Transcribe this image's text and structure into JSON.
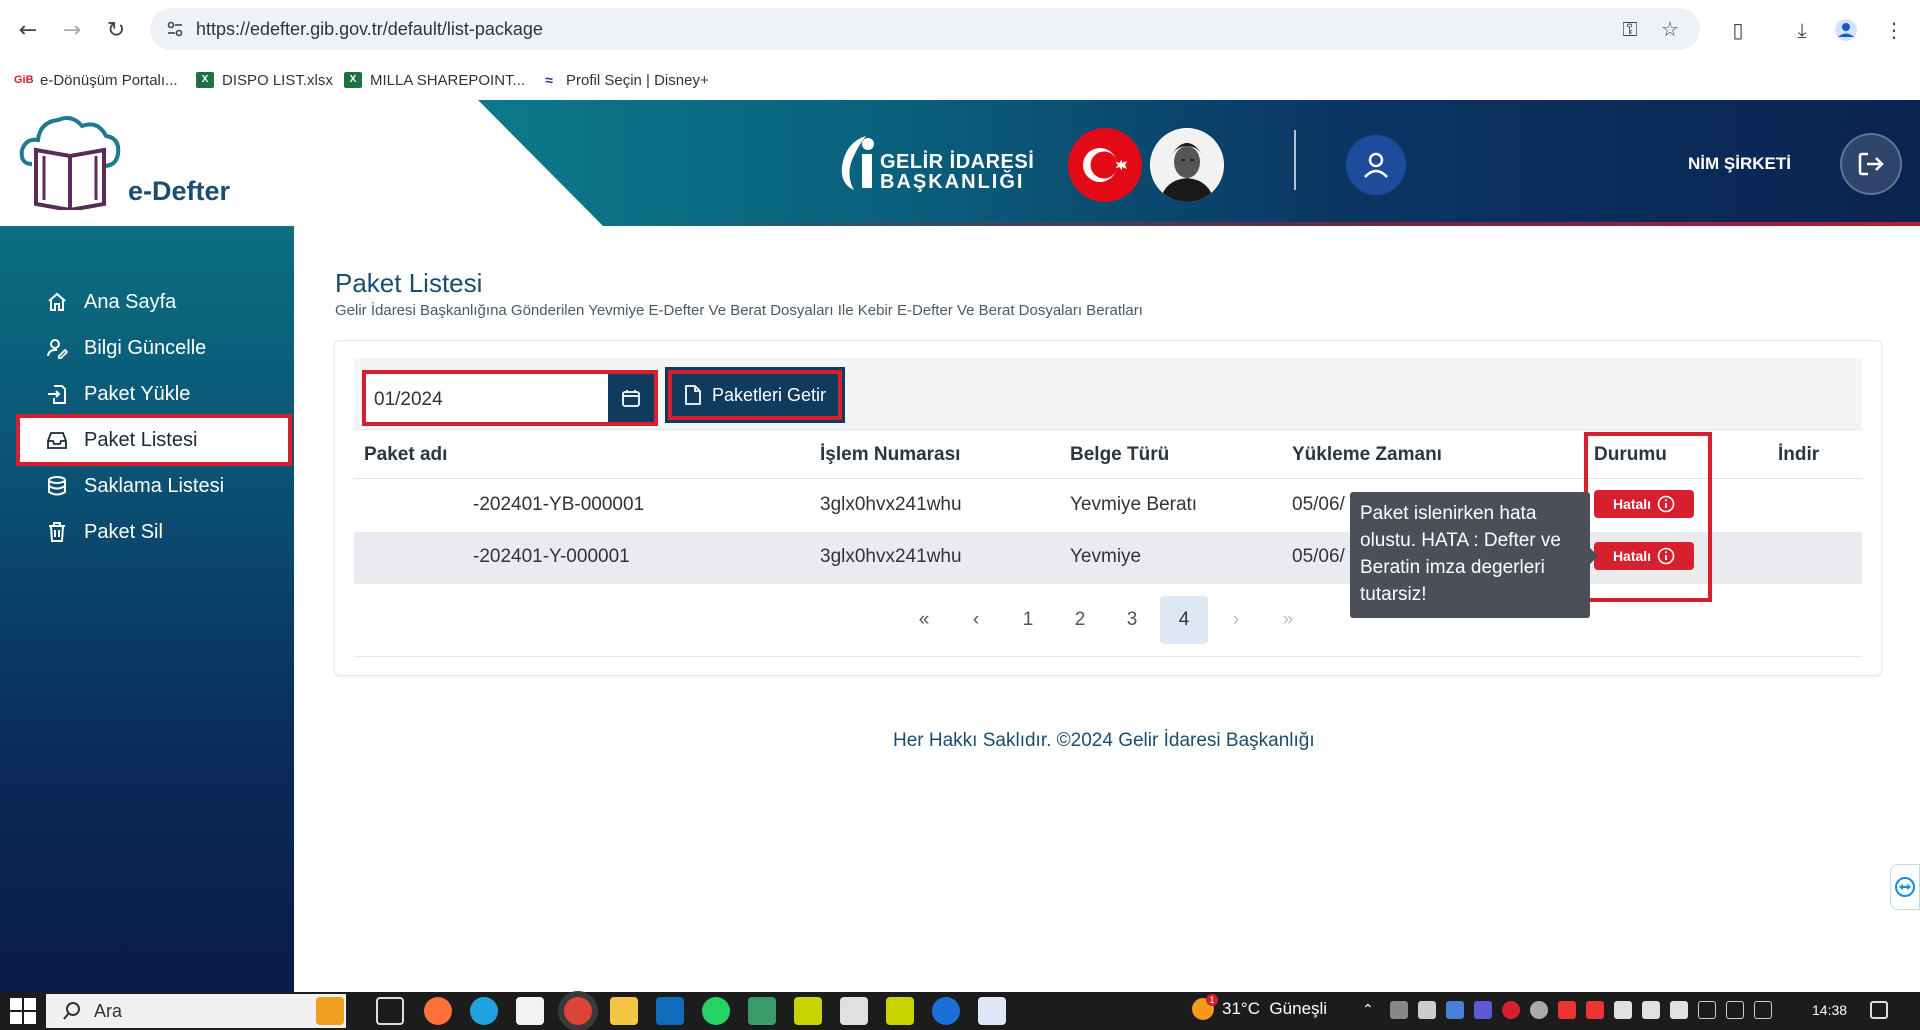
{
  "browser": {
    "url": "https://edefter.gib.gov.tr/default/list-package",
    "bookmarks": [
      {
        "label": "e-Dönüşüm Portalı...",
        "icon": "edonusum-icon",
        "color": "#d6202e"
      },
      {
        "label": "DISPO LIST.xlsx",
        "icon": "excel-icon",
        "color": "#1e7145"
      },
      {
        "label": "MILLA SHAREPOINT...",
        "icon": "excel-icon",
        "color": "#1e7145"
      },
      {
        "label": "Profil Seçin | Disney+",
        "icon": "disney-icon",
        "color": "#1a3a8c"
      }
    ]
  },
  "header": {
    "logo_text": "e-Defter",
    "gib_line1": "GELİR İDARESİ",
    "gib_line2": "BAŞKANLIĞI",
    "company": "NİM ŞİRKETİ"
  },
  "sidebar": {
    "items": [
      {
        "label": "Ana Sayfa",
        "icon": "home-icon"
      },
      {
        "label": "Bilgi Güncelle",
        "icon": "user-edit-icon"
      },
      {
        "label": "Paket Yükle",
        "icon": "upload-icon"
      },
      {
        "label": "Paket Listesi",
        "icon": "inbox-icon",
        "active": true
      },
      {
        "label": "Saklama Listesi",
        "icon": "database-icon"
      },
      {
        "label": "Paket Sil",
        "icon": "trash-icon"
      }
    ]
  },
  "main": {
    "title": "Paket Listesi",
    "subtitle": "Gelir İdaresi Başkanlığına Gönderilen Yevmiye E-Defter Ve Berat Dosyaları Ile Kebir E-Defter Ve Berat Dosyaları Beratları",
    "filter": {
      "date_value": "01/2024",
      "fetch_label": "Paketleri Getir"
    },
    "table": {
      "headers": [
        "Paket adı",
        "İşlem Numarası",
        "Belge Türü",
        "Yükleme Zamanı",
        "Durumu",
        "İndir"
      ],
      "rows": [
        {
          "name": "-202401-YB-000001",
          "islem": "3glx0hvx241whu",
          "tur": "Yevmiye Beratı",
          "zaman": "05/06/",
          "durum": "Hatalı"
        },
        {
          "name": "-202401-Y-000001",
          "islem": "3glx0hvx241whu",
          "tur": "Yevmiye",
          "zaman": "05/06/",
          "durum": "Hatalı"
        }
      ]
    },
    "tooltip": "Paket islenirken hata olustu. HATA : Defter ve Beratin imza degerleri tutarsiz!",
    "pagination": {
      "first": "«",
      "prev": "‹",
      "pages": [
        "1",
        "2",
        "3",
        "4"
      ],
      "current": "4",
      "next": "›",
      "last": "»"
    }
  },
  "footer": "Her Hakkı Saklıdır. ©2024 Gelir İdaresi Başkanlığı",
  "taskbar": {
    "search_label": "Ara",
    "weather": "31°C  Güneşli",
    "weather_badge": "1",
    "time": "14:38"
  }
}
